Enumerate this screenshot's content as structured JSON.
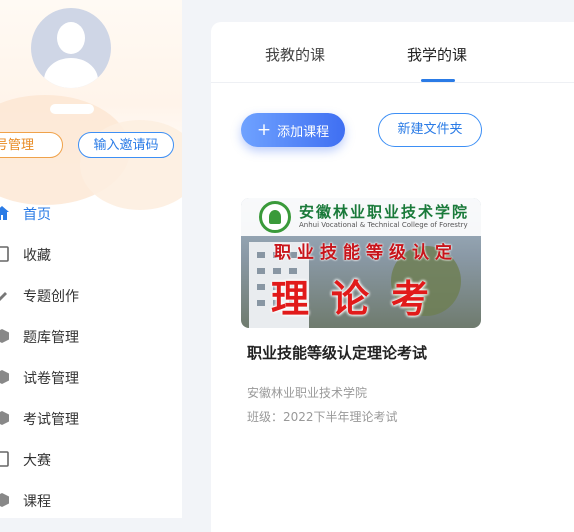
{
  "sidebar": {
    "account_button": "号管理",
    "invite_button": "输入邀请码",
    "items": [
      {
        "label": "首页",
        "icon": "home-icon"
      },
      {
        "label": "收藏",
        "icon": "bookmark-icon"
      },
      {
        "label": "专题创作",
        "icon": "pen-icon"
      },
      {
        "label": "题库管理",
        "icon": "cube-icon"
      },
      {
        "label": "试卷管理",
        "icon": "cube-icon"
      },
      {
        "label": "考试管理",
        "icon": "cube-icon"
      },
      {
        "label": "大赛",
        "icon": "doc-icon"
      },
      {
        "label": "课程",
        "icon": "cube-icon"
      }
    ],
    "active_index": 0
  },
  "tabs": {
    "teach": "我教的课",
    "learn": "我学的课",
    "active": "learn"
  },
  "toolbar": {
    "add_course": "添加课程",
    "new_folder": "新建文件夹"
  },
  "course": {
    "title": "职业技能等级认定理论考试",
    "school": "安徽林业职业技术学院",
    "class": "班级：2022下半年理论考试",
    "cover": {
      "school_name": "安徽林业职业技术学院",
      "school_en": "Anhui Vocational & Technical College of Forestry",
      "line1": "职业技能等级认定",
      "line2": "理论考试"
    }
  },
  "colors": {
    "accent": "#2a7be6",
    "orange": "#e88b24",
    "cover_red": "#e11a1a"
  }
}
